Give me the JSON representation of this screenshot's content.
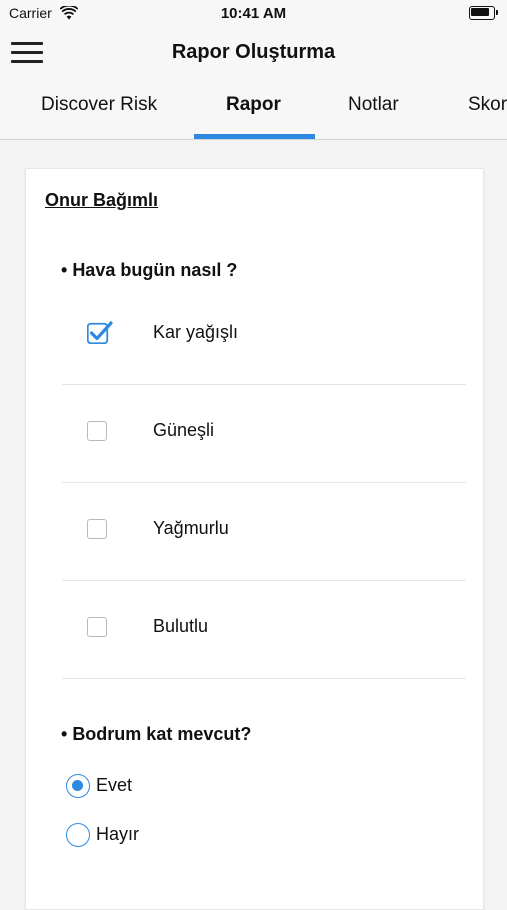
{
  "status_bar": {
    "carrier": "Carrier",
    "time": "10:41 AM",
    "wifi_icon": "wifi-icon",
    "battery_icon": "battery-icon"
  },
  "nav": {
    "title": "Rapor Oluşturma",
    "menu_icon": "hamburger-menu-icon"
  },
  "tabs": [
    {
      "label": "Discover Risk",
      "active": false
    },
    {
      "label": "Rapor",
      "active": true
    },
    {
      "label": "Notlar",
      "active": false
    },
    {
      "label": "Skor",
      "active": false
    }
  ],
  "report": {
    "person_name": "Onur Bağımlı",
    "questions": [
      {
        "bullet": "•",
        "title": "Hava bugün nasıl ?",
        "type": "checkbox",
        "options": [
          {
            "label": "Kar yağışlı",
            "checked": true
          },
          {
            "label": "Güneşli",
            "checked": false
          },
          {
            "label": "Yağmurlu",
            "checked": false
          },
          {
            "label": "Bulutlu",
            "checked": false
          }
        ]
      },
      {
        "bullet": "•",
        "title": "Bodrum kat mevcut?",
        "type": "radio",
        "options": [
          {
            "label": "Evet",
            "selected": true
          },
          {
            "label": "Hayır",
            "selected": false
          }
        ]
      }
    ]
  },
  "colors": {
    "accent": "#2d8ae0",
    "bar_background": "#f7f7f7",
    "page_background": "#f3f3f3"
  }
}
